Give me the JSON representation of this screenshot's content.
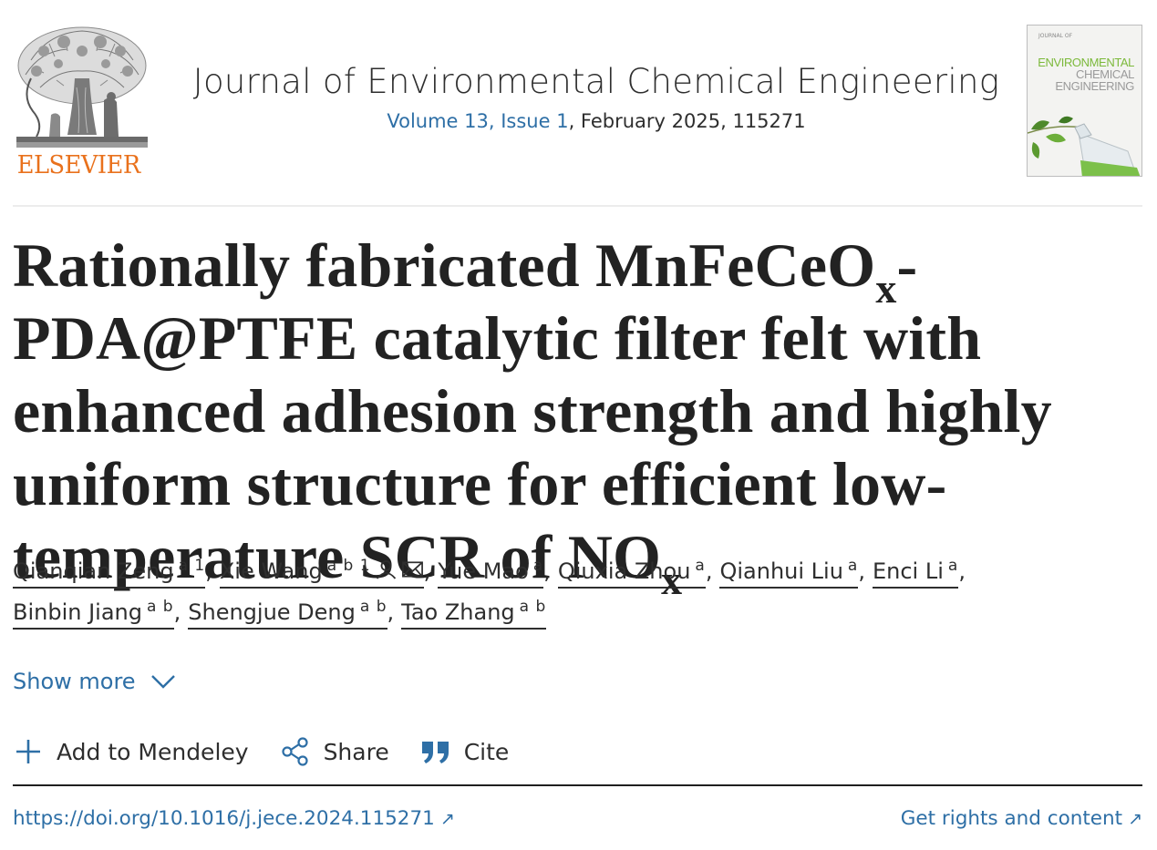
{
  "header": {
    "publisher_name": "ELSEVIER",
    "journal_title": "Journal of Environmental Chemical Engineering",
    "issue_link": "Volume 13, Issue 1",
    "issue_rest": ", February 2025, 115271",
    "cover": {
      "line1": "ENVIRONMENTAL",
      "line2": "CHEMICAL",
      "line3": "ENGINEERING",
      "small": "JOURNAL OF"
    }
  },
  "article": {
    "title_part1": "Rationally fabricated MnFeCeO",
    "title_sub1": "x",
    "title_part2": "-PDA@PTFE catalytic filter felt with enhanced adhesion strength and highly uniform structure for efficient low-temperature SCR of NO",
    "title_sub2": "x"
  },
  "authors": [
    {
      "name": "Qianqian Zeng",
      "aff": "a 1"
    },
    {
      "name": "Xie Wang",
      "aff": "a b 1"
    },
    {
      "name": "Yue Mao",
      "aff": "a"
    },
    {
      "name": "Qiuxia Zhou",
      "aff": "a"
    },
    {
      "name": "Qianhui Liu",
      "aff": "a"
    },
    {
      "name": "Enci Li",
      "aff": "a"
    },
    {
      "name": "Binbin Jiang",
      "aff": "a b"
    },
    {
      "name": "Shengjue Deng",
      "aff": "a b"
    },
    {
      "name": "Tao Zhang",
      "aff": "a b"
    }
  ],
  "show_more_label": "Show more",
  "toolbar": {
    "mendeley_label": "Add to Mendeley",
    "share_label": "Share",
    "cite_label": "Cite"
  },
  "links": {
    "doi": "https://doi.org/10.1016/j.jece.2024.115271",
    "rights": "Get rights and content",
    "arrow": "↗"
  },
  "colors": {
    "link_blue": "#2e6fa6",
    "elsevier_orange": "#e9711c",
    "text": "#2e2e2e"
  }
}
